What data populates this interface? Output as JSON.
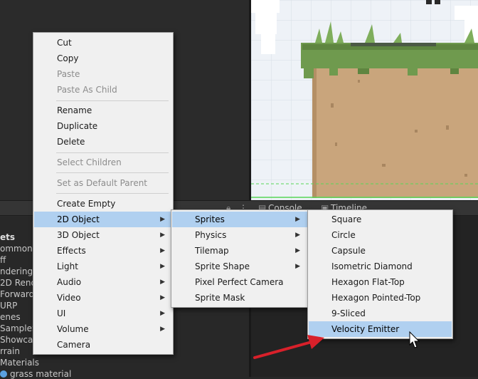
{
  "bottom_tabs": {
    "console": "Console",
    "timeline": "Timeline"
  },
  "project_tree": [
    "ets",
    "ommon",
    "ff",
    "ndering",
    "2D Rend",
    "Forward",
    "URP",
    "enes",
    "SampleS",
    "Showca",
    "rrain",
    "Materials",
    "grass material"
  ],
  "context_menu": {
    "items": [
      {
        "label": "Cut",
        "disabled": false
      },
      {
        "label": "Copy",
        "disabled": false
      },
      {
        "label": "Paste",
        "disabled": true
      },
      {
        "label": "Paste As Child",
        "disabled": true
      },
      {
        "label": "Rename",
        "disabled": false
      },
      {
        "label": "Duplicate",
        "disabled": false
      },
      {
        "label": "Delete",
        "disabled": false
      },
      {
        "label": "Select Children",
        "disabled": true
      },
      {
        "label": "Set as Default Parent",
        "disabled": true
      },
      {
        "label": "Create Empty",
        "disabled": false
      },
      {
        "label": "2D Object",
        "submenu": true,
        "highlighted": true
      },
      {
        "label": "3D Object",
        "submenu": true
      },
      {
        "label": "Effects",
        "submenu": true
      },
      {
        "label": "Light",
        "submenu": true
      },
      {
        "label": "Audio",
        "submenu": true
      },
      {
        "label": "Video",
        "submenu": true
      },
      {
        "label": "UI",
        "submenu": true
      },
      {
        "label": "Volume",
        "submenu": true
      },
      {
        "label": "Camera",
        "submenu": false
      }
    ]
  },
  "submenu_2d": {
    "items": [
      {
        "label": "Sprites",
        "submenu": true,
        "highlighted": true
      },
      {
        "label": "Physics",
        "submenu": true
      },
      {
        "label": "Tilemap",
        "submenu": true
      },
      {
        "label": "Sprite Shape",
        "submenu": true
      },
      {
        "label": "Pixel Perfect Camera",
        "submenu": false
      },
      {
        "label": "Sprite Mask",
        "submenu": false
      }
    ]
  },
  "submenu_sprites": {
    "items": [
      {
        "label": "Square"
      },
      {
        "label": "Circle"
      },
      {
        "label": "Capsule"
      },
      {
        "label": "Isometric Diamond"
      },
      {
        "label": "Hexagon Flat-Top"
      },
      {
        "label": "Hexagon Pointed-Top"
      },
      {
        "label": "9-Sliced"
      },
      {
        "label": "Velocity Emitter",
        "highlighted": true
      }
    ]
  },
  "colors": {
    "menu_bg": "#f0f0f0",
    "menu_highlight": "#b0d0f0",
    "editor_bg": "#282828",
    "arrow": "#d8202a",
    "grass": "#6f9a4e",
    "dirt": "#c9a57c"
  }
}
